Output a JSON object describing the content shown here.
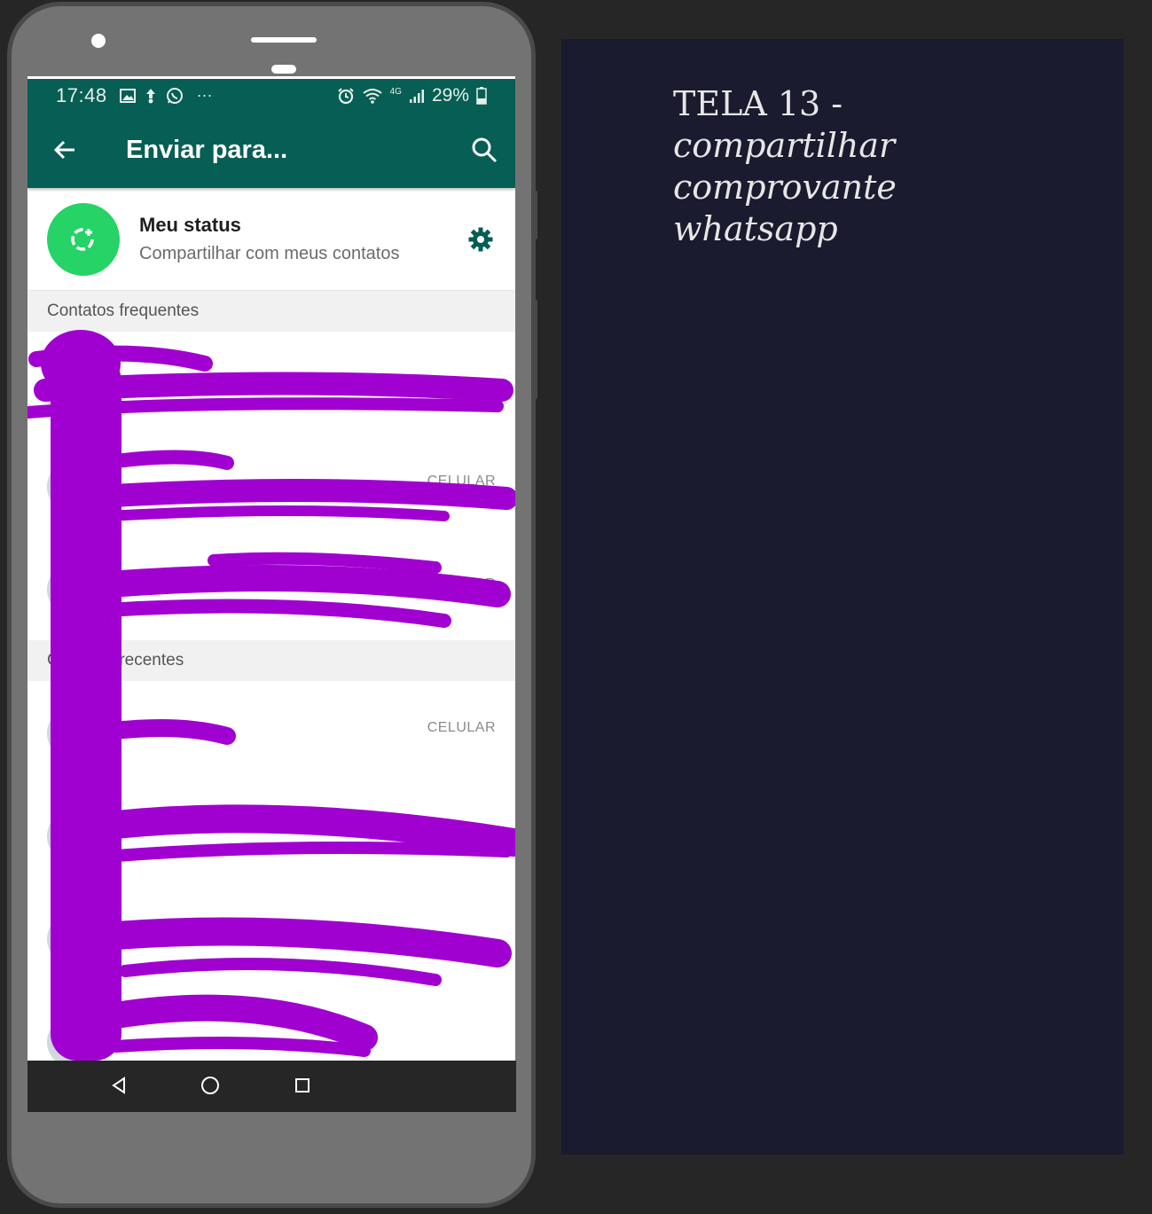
{
  "status_bar": {
    "time": "17:48",
    "more_icons": "···",
    "network": "4G",
    "battery": "29%",
    "icons_left": [
      "image-icon",
      "upload-icon",
      "whatsapp-icon"
    ],
    "icons_right": [
      "alarm-icon",
      "wifi-icon",
      "signal-icon",
      "battery-icon"
    ]
  },
  "app_bar": {
    "title": "Enviar para...",
    "back_icon": "arrow-left-icon",
    "search_icon": "search-icon"
  },
  "my_status": {
    "name": "Meu status",
    "subtitle": "Compartilhar com meus contatos",
    "settings_icon": "gear-icon"
  },
  "sections": [
    {
      "header": "Contatos frequentes"
    },
    {
      "header": "Contatos recentes"
    }
  ],
  "frequent_contacts": [
    {
      "label": ""
    },
    {
      "label": "CELULAR"
    },
    {
      "label": "CELULAR"
    }
  ],
  "recent_contacts": [
    {
      "label": "CELULAR"
    },
    {
      "label": ""
    },
    {
      "label": ""
    },
    {
      "label": ""
    }
  ],
  "nav_bar": {
    "buttons": [
      "back-nav-icon",
      "home-nav-icon",
      "recents-nav-icon"
    ]
  },
  "side_panel": {
    "title_line": "TELA 13 -",
    "subtitle_lines": [
      "compartilhar",
      "comprovante",
      "whatsapp"
    ]
  },
  "colors": {
    "whatsapp_header": "#075e54",
    "status_green": "#25d366",
    "redaction": "#a000d0",
    "panel_bg": "#1b1b2f",
    "phone_body": "#737373"
  }
}
